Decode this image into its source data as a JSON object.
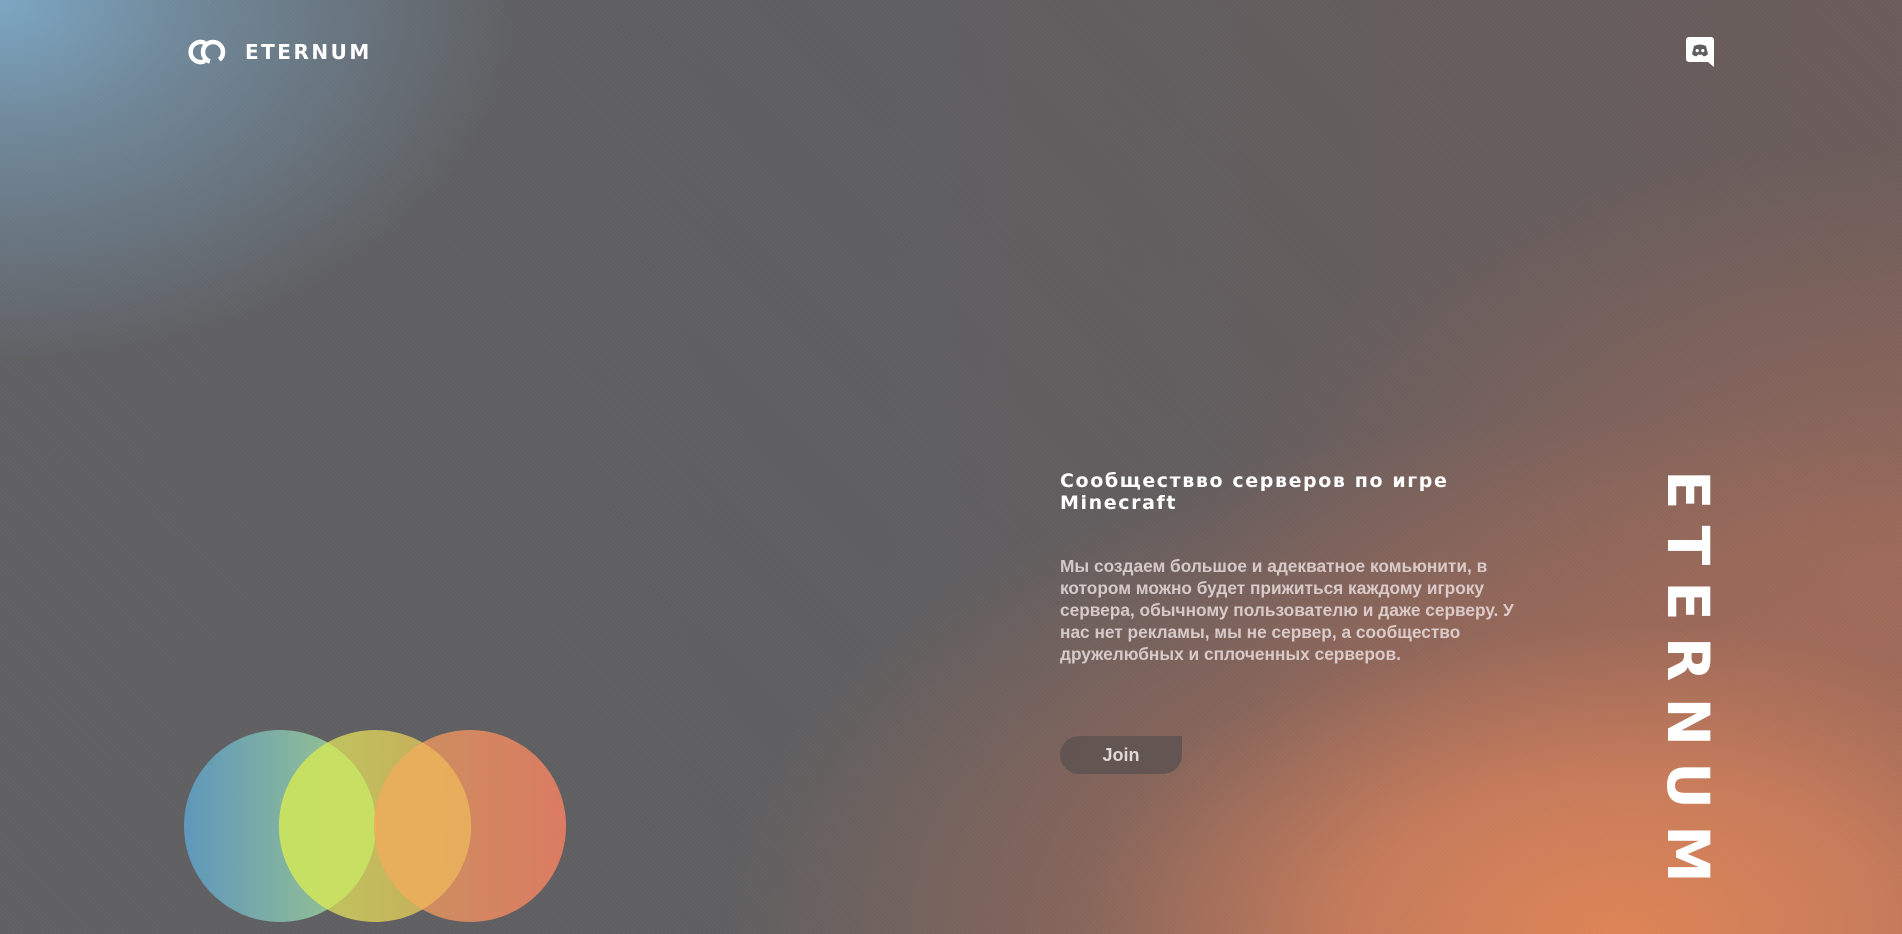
{
  "header": {
    "logo_text": "ETERNUM",
    "logo_icon": "infinity-loop-icon",
    "discord_icon": "discord-icon"
  },
  "hero": {
    "headline": "Сообществво серверов по игре Minecraft",
    "description": "Мы создаем большое и адекватное комьюнити, в котором можно будет прижиться каждому игроку сервера, обычному пользователю и даже серверу. У нас нет рекламы, мы не сервер, а сообщество дружелюбных и сплоченных серверов.",
    "join_label": "Join",
    "vertical_brand": "ETERNUM"
  },
  "colors": {
    "accent_blue": "#6fa3c0",
    "accent_green": "#cbe36a",
    "accent_orange": "#e8825f",
    "button_bg": "#5c5250"
  }
}
